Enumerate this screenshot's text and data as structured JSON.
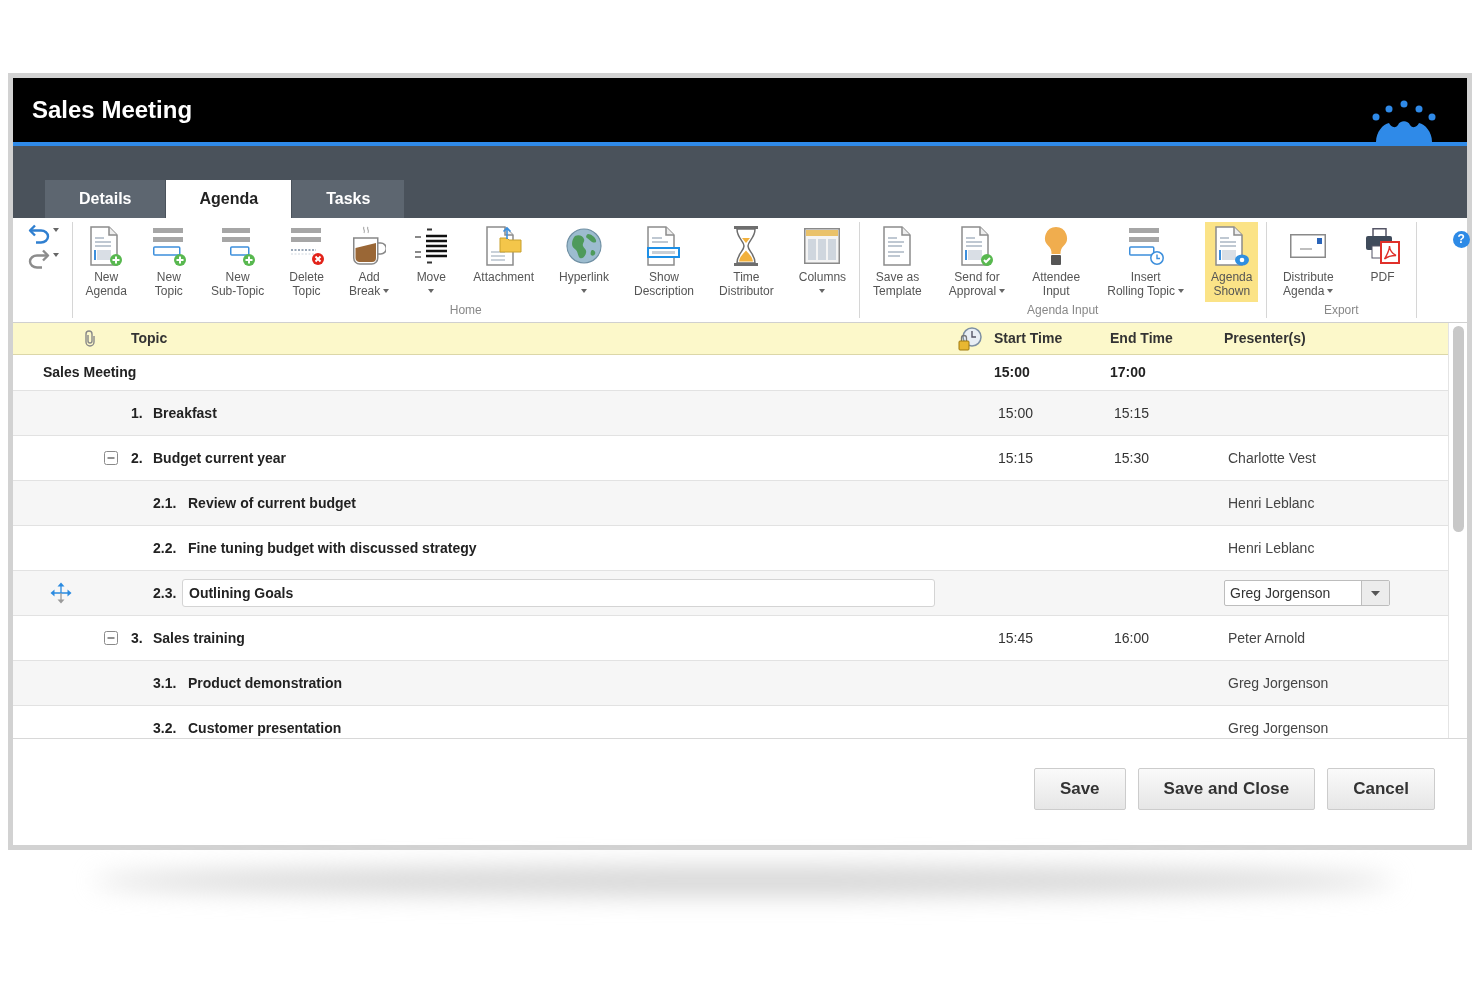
{
  "window": {
    "title": "Sales Meeting"
  },
  "tabs": [
    {
      "label": "Details",
      "selected": false
    },
    {
      "label": "Agenda",
      "selected": true
    },
    {
      "label": "Tasks",
      "selected": false
    }
  ],
  "toolbar": {
    "history": [
      {
        "disabled": false,
        "menu": true
      },
      {
        "disabled": true,
        "menu": true
      }
    ],
    "groups": [
      {
        "label": "Home",
        "buttons": [
          {
            "label": [
              "New",
              "Agenda"
            ],
            "menu": false,
            "on": false
          },
          {
            "label": [
              "New",
              "Topic"
            ],
            "menu": false,
            "on": false
          },
          {
            "label": [
              "New",
              "Sub-Topic"
            ],
            "menu": false,
            "on": false
          },
          {
            "label": [
              "Delete",
              "Topic"
            ],
            "menu": false,
            "on": false
          },
          {
            "label": [
              "Add",
              "Break"
            ],
            "menu": true,
            "on": false
          },
          {
            "label": [
              "Move"
            ],
            "menu": true,
            "on": false
          },
          {
            "label": [
              "Attachment"
            ],
            "menu": false,
            "on": false
          },
          {
            "label": [
              "Hyperlink"
            ],
            "menu": true,
            "on": false
          },
          {
            "label": [
              "Show",
              "Description"
            ],
            "menu": false,
            "on": false
          },
          {
            "label": [
              "Time",
              "Distributor"
            ],
            "menu": false,
            "on": false
          },
          {
            "label": [
              "Columns"
            ],
            "menu": true,
            "on": false
          }
        ]
      },
      {
        "label": "Agenda Input",
        "buttons": [
          {
            "label": [
              "Save as",
              "Template"
            ],
            "menu": false,
            "on": false
          },
          {
            "label": [
              "Send for",
              "Approval"
            ],
            "menu": true,
            "on": false
          },
          {
            "label": [
              "Attendee",
              "Input"
            ],
            "menu": false,
            "on": false
          },
          {
            "label": [
              "Insert",
              "Rolling Topic"
            ],
            "menu": true,
            "on": false
          },
          {
            "label": [
              "Agenda",
              "Shown"
            ],
            "menu": false,
            "on": true
          }
        ]
      },
      {
        "label": "Export",
        "buttons": [
          {
            "label": [
              "Distribute",
              "Agenda"
            ],
            "menu": true,
            "on": false
          },
          {
            "label": [
              "PDF"
            ],
            "menu": false,
            "on": false
          }
        ]
      }
    ],
    "help": "?"
  },
  "table": {
    "columns": [
      "Topic",
      "Start Time",
      "End Time",
      "Presenter(s)"
    ],
    "rows": [
      {
        "topic": "Sales Meeting",
        "start": "15:00",
        "end": "17:00",
        "selected": false,
        "children": [
          {
            "number": "1.",
            "topic": "Breakfast",
            "start": "15:00",
            "end": "15:15",
            "selected": false
          },
          {
            "number": "2.",
            "topic": "Budget current year",
            "start": "15:15",
            "end": "15:30",
            "presenter": "Charlotte Vest",
            "selected": false,
            "expanded": true,
            "children": [
              {
                "number": "2.1.",
                "topic": "Review of current budget",
                "presenter": "Henri Leblanc",
                "selected": false
              },
              {
                "number": "2.2.",
                "topic": "Fine tuning budget with discussed strategy",
                "presenter": "Henri Leblanc",
                "selected": false
              },
              {
                "number": "2.3.",
                "topic": "Outlining Goals",
                "presenter": "Greg Jorgenson",
                "selected": true
              }
            ]
          },
          {
            "number": "3.",
            "topic": "Sales training",
            "start": "15:45",
            "end": "16:00",
            "presenter": "Peter Arnold",
            "selected": false,
            "expanded": true,
            "children": [
              {
                "number": "3.1.",
                "topic": "Product demonstration",
                "presenter": "Greg Jorgenson",
                "selected": false
              },
              {
                "number": "3.2.",
                "topic": "Customer presentation",
                "presenter": "Greg Jorgenson",
                "selected": false
              }
            ]
          }
        ]
      }
    ]
  },
  "buttons": [
    "Save",
    "Save and Close",
    "Cancel"
  ]
}
